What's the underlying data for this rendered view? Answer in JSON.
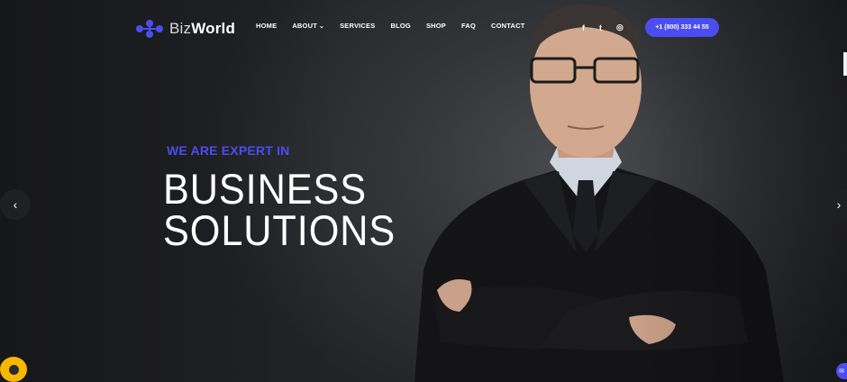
{
  "brand": {
    "name_light": "Biz",
    "name_bold": "World"
  },
  "nav": {
    "items": [
      {
        "label": "HOME",
        "active": true
      },
      {
        "label": "ABOUT",
        "has_dropdown": true
      },
      {
        "label": "SERVICES"
      },
      {
        "label": "BLOG"
      },
      {
        "label": "SHOP"
      },
      {
        "label": "FAQ"
      },
      {
        "label": "CONTACT"
      }
    ],
    "dropdown_glyph": "⌄"
  },
  "social": {
    "facebook": "f",
    "twitter": "t",
    "instagram": "◎"
  },
  "phone_button": {
    "label": "+1 (800) 333 44 55"
  },
  "hero": {
    "tagline": "WE ARE EXPERT IN",
    "headline_line1": "BUSINESS",
    "headline_line2": "SOLUTIONS"
  },
  "slider": {
    "prev_glyph": "‹",
    "next_glyph": "›"
  },
  "widgets": {
    "mail_glyph": "✉"
  },
  "colors": {
    "accent": "#4b4df2",
    "chat": "#f5b800",
    "background": "#2a2b2e"
  },
  "icons": [
    "logo-icon",
    "facebook-icon",
    "twitter-icon",
    "instagram-icon",
    "chevron-left-icon",
    "chevron-right-icon",
    "chat-icon",
    "mail-icon"
  ]
}
